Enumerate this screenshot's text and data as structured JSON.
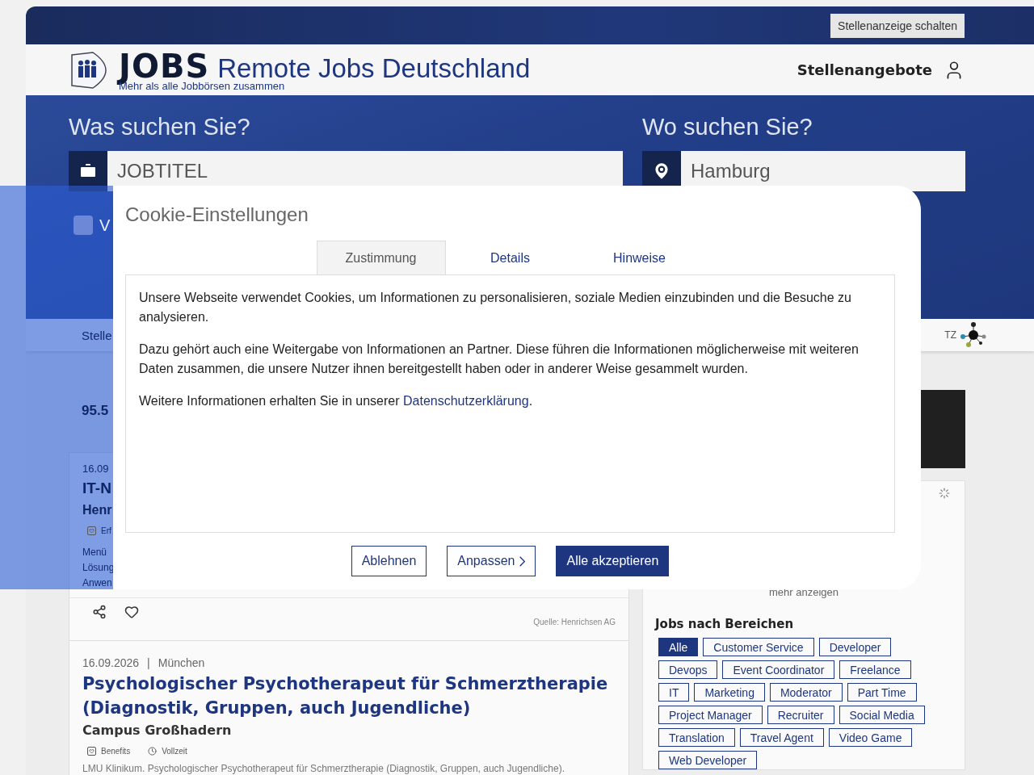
{
  "top_bar": {
    "button": "Stellenanzeige schalten"
  },
  "header": {
    "logo": "JOBS",
    "title": "Remote Jobs Deutschland",
    "tagline": "Mehr als alle Jobbörsen zusammen",
    "nav_link": "Stellenangebote"
  },
  "search": {
    "what_label": "Was suchen Sie?",
    "what_placeholder": "JOBTITEL",
    "where_label": "Wo suchen Sie?",
    "where_value": "Hamburg",
    "option": {
      "label": "V",
      "checked": false
    }
  },
  "nav": {
    "item": "Stelle",
    "partner_logo": "TZ"
  },
  "results": {
    "count": "95.5",
    "cards": [
      {
        "date": "16.09",
        "title": "IT-N",
        "company": "Henr",
        "tags": [
          "Erf"
        ],
        "description_lines": [
          "Menü",
          "Lösung",
          "Anwen"
        ],
        "source": "Quelle: Henrichsen AG"
      },
      {
        "date": "16.09.2026",
        "separator": "|",
        "location": "München",
        "title": "Psychologischer Psychotherapeut für Schmerztherapie (Diagnostik, Gruppen, auch Jugendliche)",
        "company": "Campus Großhadern",
        "tags": [
          "Benefits",
          "Vollzeit"
        ],
        "description_lines": [
          "LMU Klinikum. Psychologischer Psychotherapeut für Schmerztherapie (Diagnostik, Gruppen, auch Jugendliche)."
        ]
      }
    ]
  },
  "sidebar": {
    "more": "mehr anzeigen",
    "categories_title": "Jobs nach Bereichen",
    "categories": [
      {
        "label": "Alle",
        "selected": true
      },
      {
        "label": "Customer Service",
        "selected": false
      },
      {
        "label": "Developer",
        "selected": false
      },
      {
        "label": "Devops",
        "selected": false
      },
      {
        "label": "Event Coordinator",
        "selected": false
      },
      {
        "label": "Freelance",
        "selected": false
      },
      {
        "label": "IT",
        "selected": false
      },
      {
        "label": "Marketing",
        "selected": false
      },
      {
        "label": "Moderator",
        "selected": false
      },
      {
        "label": "Part Time",
        "selected": false
      },
      {
        "label": "Project Manager",
        "selected": false
      },
      {
        "label": "Recruiter",
        "selected": false
      },
      {
        "label": "Social Media",
        "selected": false
      },
      {
        "label": "Translation",
        "selected": false
      },
      {
        "label": "Travel Agent",
        "selected": false
      },
      {
        "label": "Video Game",
        "selected": false
      },
      {
        "label": "Web Developer",
        "selected": false
      }
    ]
  },
  "cookie_dialog": {
    "title": "Cookie-Einstellungen",
    "tabs": [
      {
        "label": "Zustimmung",
        "selected": true
      },
      {
        "label": "Details",
        "selected": false
      },
      {
        "label": "Hinweise",
        "selected": false
      }
    ],
    "paragraphs": [
      "Unsere Webseite verwendet Cookies, um Informationen zu personalisieren, soziale Medien einzubinden und die Besuche zu analysieren.",
      "Dazu gehört auch eine Weitergabe von Informationen an Partner. Diese führen die Informationen möglicherweise mit weiteren Daten zusammen, die unsere Nutzer ihnen bereitgestellt haben oder in anderer Weise gesammelt wurden."
    ],
    "link_paragraph": {
      "before": "Weitere Informationen erhalten Sie in unserer ",
      "link": "Datenschutzerklärung",
      "after": "."
    },
    "buttons": [
      {
        "label": "Ablehnen",
        "kind": "outline"
      },
      {
        "label": "Anpassen",
        "kind": "chevron"
      },
      {
        "label": "Alle akzeptieren",
        "kind": "primary"
      }
    ]
  }
}
